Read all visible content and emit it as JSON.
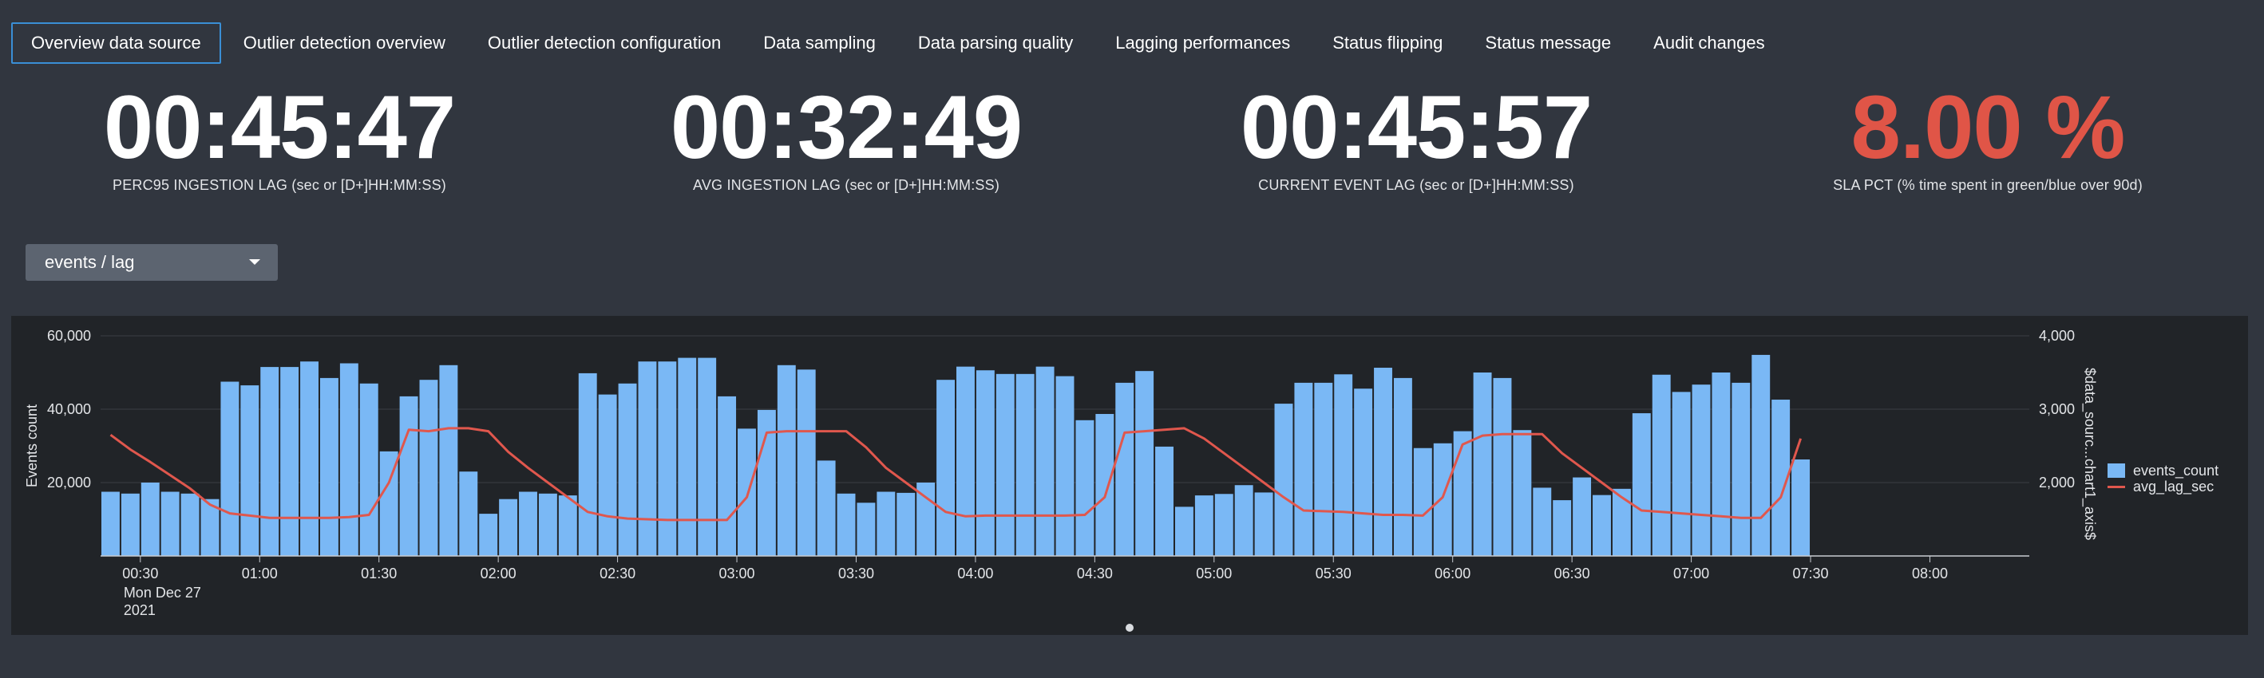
{
  "tabs": [
    {
      "label": "Overview data source",
      "active": true
    },
    {
      "label": "Outlier detection overview",
      "active": false
    },
    {
      "label": "Outlier detection configuration",
      "active": false
    },
    {
      "label": "Data sampling",
      "active": false
    },
    {
      "label": "Data parsing quality",
      "active": false
    },
    {
      "label": "Lagging performances",
      "active": false
    },
    {
      "label": "Status flipping",
      "active": false
    },
    {
      "label": "Status message",
      "active": false
    },
    {
      "label": "Audit changes",
      "active": false
    }
  ],
  "kpis": [
    {
      "value": "00:45:47",
      "label": "PERC95 INGESTION LAG (sec or [D+]HH:MM:SS)"
    },
    {
      "value": "00:32:49",
      "label": "AVG INGESTION LAG (sec or [D+]HH:MM:SS)"
    },
    {
      "value": "00:45:57",
      "label": "CURRENT EVENT LAG (sec or [D+]HH:MM:SS)"
    },
    {
      "value": "8.00 %",
      "label": "SLA PCT (% time spent in green/blue over 90d)"
    }
  ],
  "dropdown": {
    "selected": "events / lag"
  },
  "colors": {
    "bar": "#7ab8f5",
    "line": "#e0574d",
    "sla_red": "#e05547",
    "tab_active_border": "#3a8fd6"
  },
  "chart_data": {
    "type": "bar",
    "title": "",
    "xlabel": "",
    "ylabel": "Events count",
    "y2label": "$data_sourc...chart1_axis$",
    "ylim": [
      0,
      60000
    ],
    "y2lim": [
      1000,
      4000
    ],
    "yticks": [
      "20,000",
      "40,000",
      "60,000"
    ],
    "y2ticks": [
      "2,000",
      "3,000",
      "4,000"
    ],
    "xticks": [
      "00:30",
      "01:00",
      "01:30",
      "02:00",
      "02:30",
      "03:00",
      "03:30",
      "04:00",
      "04:30",
      "05:00",
      "05:30",
      "06:00",
      "06:30",
      "07:00",
      "07:30",
      "08:00"
    ],
    "xdate": [
      "Mon Dec 27",
      "2021"
    ],
    "x_start": "00:20",
    "x_end": "08:25",
    "bar_interval_minutes": 5,
    "grid": true,
    "legend_position": "right",
    "series": [
      {
        "name": "events_count",
        "type": "bar",
        "axis": "left",
        "values": [
          17500,
          17000,
          20000,
          17500,
          17000,
          15500,
          47500,
          46500,
          51500,
          51500,
          53000,
          48500,
          52500,
          47000,
          28500,
          43500,
          48000,
          52000,
          23000,
          11500,
          15500,
          17500,
          17000,
          16500,
          49800,
          44000,
          47000,
          53000,
          53000,
          54000,
          54000,
          43500,
          34700,
          39800,
          52000,
          50800,
          26000,
          17000,
          14500,
          17500,
          17200,
          20000,
          48000,
          51600,
          50600,
          49600,
          49600,
          51600,
          49000,
          37000,
          38700,
          47200,
          50400,
          29800,
          13400,
          16500,
          16900,
          19300,
          17300,
          41500,
          47200,
          47200,
          49500,
          45600,
          51300,
          48500,
          29400,
          30700,
          34000,
          50000,
          48500,
          34300,
          18600,
          15200,
          21400,
          16600,
          18300,
          38900,
          49400,
          44700,
          46700,
          50000,
          47200,
          54800,
          42600,
          26300
        ]
      },
      {
        "name": "avg_lag_sec",
        "type": "line",
        "axis": "right",
        "values": [
          2650,
          2450,
          2280,
          2100,
          1920,
          1700,
          1580,
          1550,
          1520,
          1520,
          1520,
          1520,
          1530,
          1560,
          2000,
          2720,
          2700,
          2740,
          2740,
          2700,
          2420,
          2200,
          2000,
          1800,
          1600,
          1540,
          1510,
          1500,
          1490,
          1490,
          1490,
          1490,
          1800,
          2680,
          2700,
          2700,
          2700,
          2700,
          2480,
          2200,
          2000,
          1800,
          1600,
          1540,
          1550,
          1550,
          1550,
          1550,
          1550,
          1560,
          1800,
          2680,
          2700,
          2720,
          2740,
          2600,
          2400,
          2200,
          2000,
          1800,
          1620,
          1610,
          1600,
          1580,
          1560,
          1560,
          1550,
          1800,
          2520,
          2640,
          2660,
          2660,
          2660,
          2400,
          2200,
          2000,
          1800,
          1620,
          1600,
          1580,
          1560,
          1540,
          1520,
          1520,
          1800,
          2600
        ]
      }
    ]
  }
}
